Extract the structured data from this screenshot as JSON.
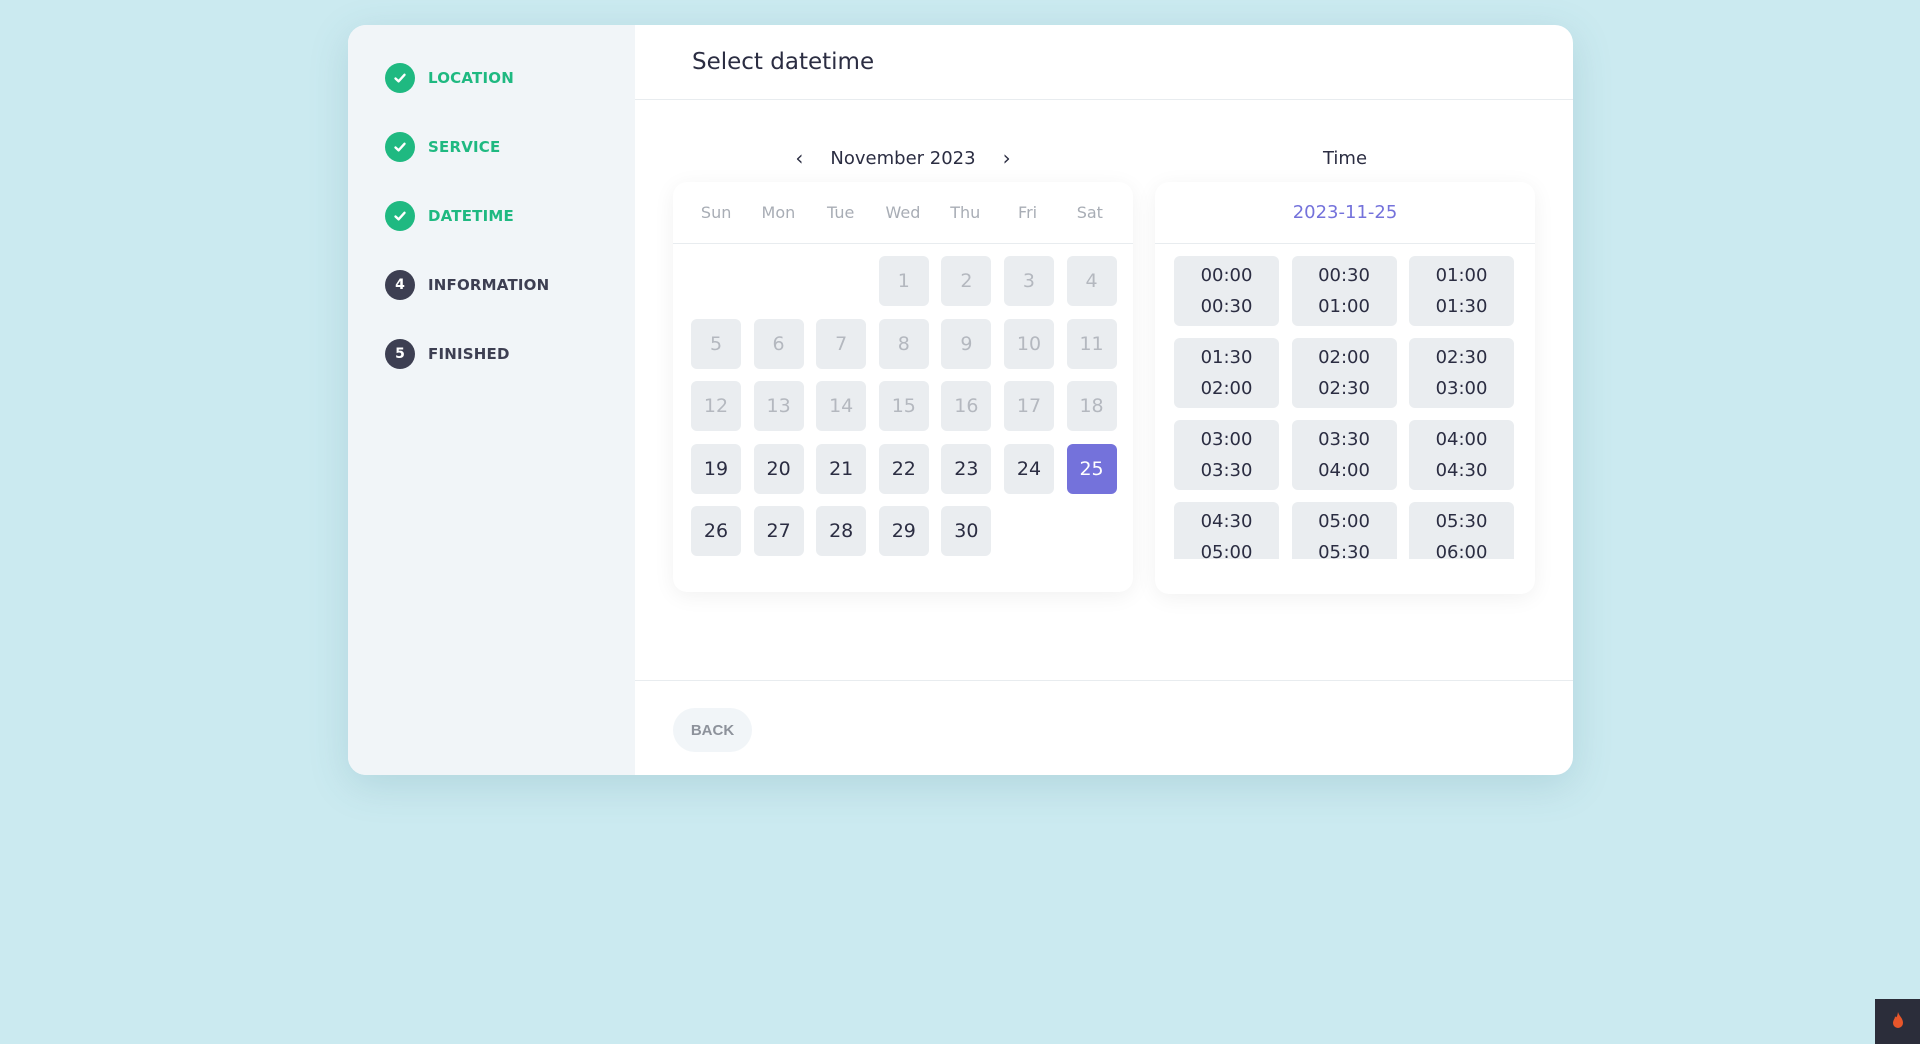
{
  "steps": [
    {
      "label": "LOCATION",
      "state": "done"
    },
    {
      "label": "SERVICE",
      "state": "done"
    },
    {
      "label": "DATETIME",
      "state": "done"
    },
    {
      "label": "INFORMATION",
      "state": "todo",
      "number": "4"
    },
    {
      "label": "FINISHED",
      "state": "todo",
      "number": "5"
    }
  ],
  "header": {
    "title": "Select datetime"
  },
  "calendar": {
    "month_label": "November 2023",
    "prev_icon": "chevron-left-icon",
    "next_icon": "chevron-right-icon",
    "weekdays": [
      "Sun",
      "Mon",
      "Tue",
      "Wed",
      "Thu",
      "Fri",
      "Sat"
    ],
    "leading_blanks": 3,
    "days": [
      {
        "d": "1",
        "s": "disabled"
      },
      {
        "d": "2",
        "s": "disabled"
      },
      {
        "d": "3",
        "s": "disabled"
      },
      {
        "d": "4",
        "s": "disabled"
      },
      {
        "d": "5",
        "s": "disabled"
      },
      {
        "d": "6",
        "s": "disabled"
      },
      {
        "d": "7",
        "s": "disabled"
      },
      {
        "d": "8",
        "s": "disabled"
      },
      {
        "d": "9",
        "s": "disabled"
      },
      {
        "d": "10",
        "s": "disabled"
      },
      {
        "d": "11",
        "s": "disabled"
      },
      {
        "d": "12",
        "s": "disabled"
      },
      {
        "d": "13",
        "s": "disabled"
      },
      {
        "d": "14",
        "s": "disabled"
      },
      {
        "d": "15",
        "s": "disabled"
      },
      {
        "d": "16",
        "s": "disabled"
      },
      {
        "d": "17",
        "s": "disabled"
      },
      {
        "d": "18",
        "s": "disabled"
      },
      {
        "d": "19",
        "s": "active"
      },
      {
        "d": "20",
        "s": "active"
      },
      {
        "d": "21",
        "s": "active"
      },
      {
        "d": "22",
        "s": "active"
      },
      {
        "d": "23",
        "s": "active"
      },
      {
        "d": "24",
        "s": "active"
      },
      {
        "d": "25",
        "s": "selected"
      },
      {
        "d": "26",
        "s": "active"
      },
      {
        "d": "27",
        "s": "active"
      },
      {
        "d": "28",
        "s": "active"
      },
      {
        "d": "29",
        "s": "active"
      },
      {
        "d": "30",
        "s": "active"
      }
    ]
  },
  "time": {
    "title": "Time",
    "selected_date": "2023-11-25",
    "slots": [
      {
        "start": "00:00",
        "end": "00:30"
      },
      {
        "start": "00:30",
        "end": "01:00"
      },
      {
        "start": "01:00",
        "end": "01:30"
      },
      {
        "start": "01:30",
        "end": "02:00"
      },
      {
        "start": "02:00",
        "end": "02:30"
      },
      {
        "start": "02:30",
        "end": "03:00"
      },
      {
        "start": "03:00",
        "end": "03:30"
      },
      {
        "start": "03:30",
        "end": "04:00"
      },
      {
        "start": "04:00",
        "end": "04:30"
      },
      {
        "start": "04:30",
        "end": "05:00"
      },
      {
        "start": "05:00",
        "end": "05:30"
      },
      {
        "start": "05:30",
        "end": "06:00"
      }
    ]
  },
  "footer": {
    "back_label": "BACK"
  },
  "colors": {
    "accent_green": "#1fb981",
    "accent_purple": "#7472db",
    "dark": "#3d3f52"
  },
  "corner_badge_icon": "flame-icon"
}
